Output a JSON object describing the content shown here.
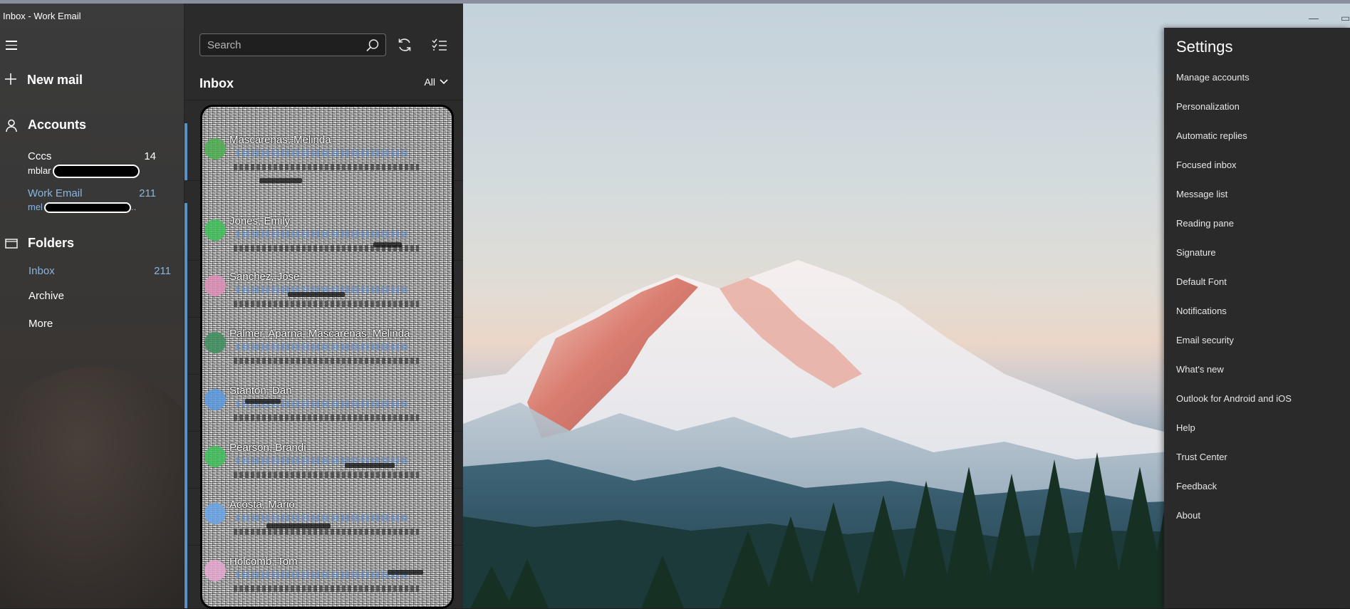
{
  "window": {
    "title": "Inbox - Work Email"
  },
  "nav": {
    "new_mail": "New mail",
    "accounts_heading": "Accounts",
    "accounts": [
      {
        "name": "Cccs",
        "count": "14",
        "email_prefix": "mblar"
      },
      {
        "name": "Work Email",
        "count": "211",
        "email_prefix": "mel"
      }
    ],
    "folders_heading": "Folders",
    "folders": [
      {
        "name": "Inbox",
        "count": "211"
      },
      {
        "name": "Archive",
        "count": ""
      },
      {
        "name": "More",
        "count": ""
      }
    ]
  },
  "list": {
    "search_placeholder": "Search",
    "title": "Inbox",
    "filter": "All",
    "messages": [
      {
        "sender": "Mascarenas, Melinda"
      },
      {
        "sender": "Jones, Emily"
      },
      {
        "sender": "Sanchez, Jose"
      },
      {
        "sender": "Palmer, Aparna; Mascarenas, Melinda"
      },
      {
        "sender": "Stanton, Dan"
      },
      {
        "sender": "Pearson, Brandi"
      },
      {
        "sender": "Acosta, Mario"
      },
      {
        "sender": "Holcomb, Tom"
      }
    ]
  },
  "settings": {
    "title": "Settings",
    "items": [
      "Manage accounts",
      "Personalization",
      "Automatic replies",
      "Focused inbox",
      "Message list",
      "Reading pane",
      "Signature",
      "Default Font",
      "Notifications",
      "Email security",
      "What's new",
      "Outlook for Android and iOS",
      "Help",
      "Trust Center",
      "Feedback",
      "About"
    ]
  },
  "colors": {
    "accent": "#5b8fc7",
    "active_text": "#8ab4dd",
    "flyout_bg": "#2a2a2a"
  },
  "icons": [
    "hamburger-icon",
    "plus-icon",
    "person-icon",
    "folder-icon",
    "search-icon",
    "sync-icon",
    "select-mode-icon",
    "chevron-down-icon"
  ]
}
